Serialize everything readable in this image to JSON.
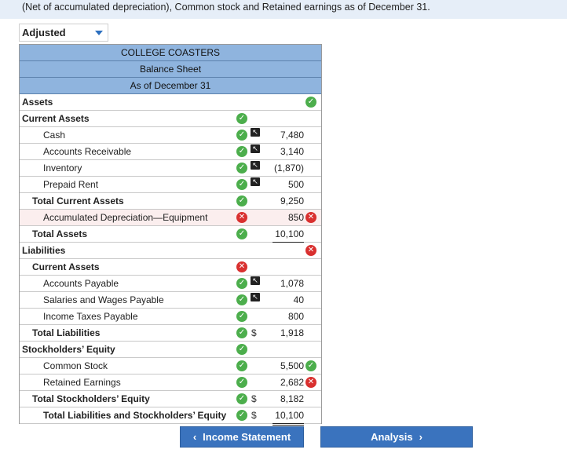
{
  "intro_text": "(Net of accumulated depreciation), Common stock and Retained earnings as of December 31.",
  "dropdown": {
    "selected": "Adjusted"
  },
  "sheet": {
    "company": "COLLEGE COASTERS",
    "statement": "Balance Sheet",
    "date": "As of December 31",
    "rows": [
      {
        "label": "Assets",
        "indent": 0,
        "bold": true,
        "right_mark": "ok"
      },
      {
        "label": "Current Assets",
        "indent": 0,
        "bold": true,
        "mark": "ok"
      },
      {
        "label": "Cash",
        "indent": 2,
        "mark": "ok",
        "arrow": true,
        "value": "7,480"
      },
      {
        "label": "Accounts Receivable",
        "indent": 2,
        "mark": "ok",
        "arrow": true,
        "value": "3,140"
      },
      {
        "label": "Inventory",
        "indent": 2,
        "mark": "ok",
        "arrow": true,
        "value": "(1,870)"
      },
      {
        "label": "Prepaid Rent",
        "indent": 2,
        "mark": "ok",
        "arrow": true,
        "value": "500"
      },
      {
        "label": "Total Current Assets",
        "indent": 1,
        "bold": true,
        "mark": "ok",
        "value": "9,250"
      },
      {
        "label": "Accumulated Depreciation—Equipment",
        "indent": 2,
        "mark": "bad",
        "value": "850",
        "value_mark": "bad",
        "highlight": true
      },
      {
        "label": "Total Assets",
        "indent": 1,
        "bold": true,
        "mark": "ok",
        "value": "10,100",
        "line": "total"
      },
      {
        "label": "Liabilities",
        "indent": 0,
        "bold": true,
        "right_mark": "bad"
      },
      {
        "label": "Current Assets",
        "indent": 1,
        "bold": true,
        "mark": "bad"
      },
      {
        "label": "Accounts Payable",
        "indent": 2,
        "mark": "ok",
        "arrow": true,
        "value": "1,078"
      },
      {
        "label": "Salaries and Wages Payable",
        "indent": 2,
        "mark": "ok",
        "arrow": true,
        "value": "40"
      },
      {
        "label": "Income Taxes Payable",
        "indent": 2,
        "mark": "ok",
        "value": "800"
      },
      {
        "label": "Total Liabilities",
        "indent": 1,
        "bold": true,
        "mark": "ok",
        "dollar": "$",
        "value": "1,918"
      },
      {
        "label": "Stockholders’ Equity",
        "indent": 0,
        "bold": true,
        "mark": "ok"
      },
      {
        "label": "Common Stock",
        "indent": 2,
        "mark": "ok",
        "value": "5,500",
        "value_mark": "ok"
      },
      {
        "label": "Retained Earnings",
        "indent": 2,
        "mark": "ok",
        "value": "2,682",
        "value_mark": "bad"
      },
      {
        "label": "Total Stockholders’ Equity",
        "indent": 1,
        "bold": true,
        "mark": "ok",
        "dollar": "$",
        "value": "8,182"
      },
      {
        "label": "Total Liabilities and Stockholders’ Equity",
        "indent": 2,
        "bold": true,
        "mark": "ok",
        "dollar": "$",
        "value": "10,100",
        "line": "double"
      }
    ]
  },
  "nav": {
    "prev_label": "Income Statement",
    "next_label": "Analysis"
  },
  "colors": {
    "header_bg": "#8fb4de",
    "ok": "#4cae4c",
    "bad": "#d9302f",
    "button": "#3a73be"
  }
}
